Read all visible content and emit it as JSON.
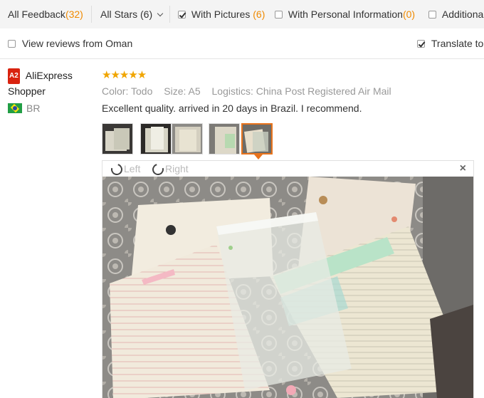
{
  "filters": {
    "all_feedback_label": "All Feedback",
    "all_feedback_count": "(32)",
    "all_stars_label": "All Stars (6)",
    "with_pictures_label": "With Pictures",
    "with_pictures_count": "(6)",
    "with_personal_label": "With Personal Information",
    "with_personal_count": "(0)",
    "additional_label": "Additiona"
  },
  "options": {
    "view_from_country": "View reviews from Oman",
    "translate_label": "Translate to"
  },
  "review": {
    "badge": "A2",
    "user_name": "AliExpress Shopper",
    "country_code": "BR",
    "stars": "★★★★★",
    "color_key": "Color:",
    "color_value": "Todo",
    "size_key": "Size:",
    "size_value": "A5",
    "logistics_key": "Logistics:",
    "logistics_value": "China Post Registered Air Mail",
    "text": "Excellent quality. arrived in 20 days in Brazil. I recommend."
  },
  "viewer": {
    "rotate_left": "Left",
    "rotate_right": "Right",
    "close": "×"
  },
  "colors": {
    "accent_orange": "#f08a00",
    "active_thumb_border": "#e8731c",
    "star_color": "#f0a500",
    "badge_red": "#d9230f"
  }
}
